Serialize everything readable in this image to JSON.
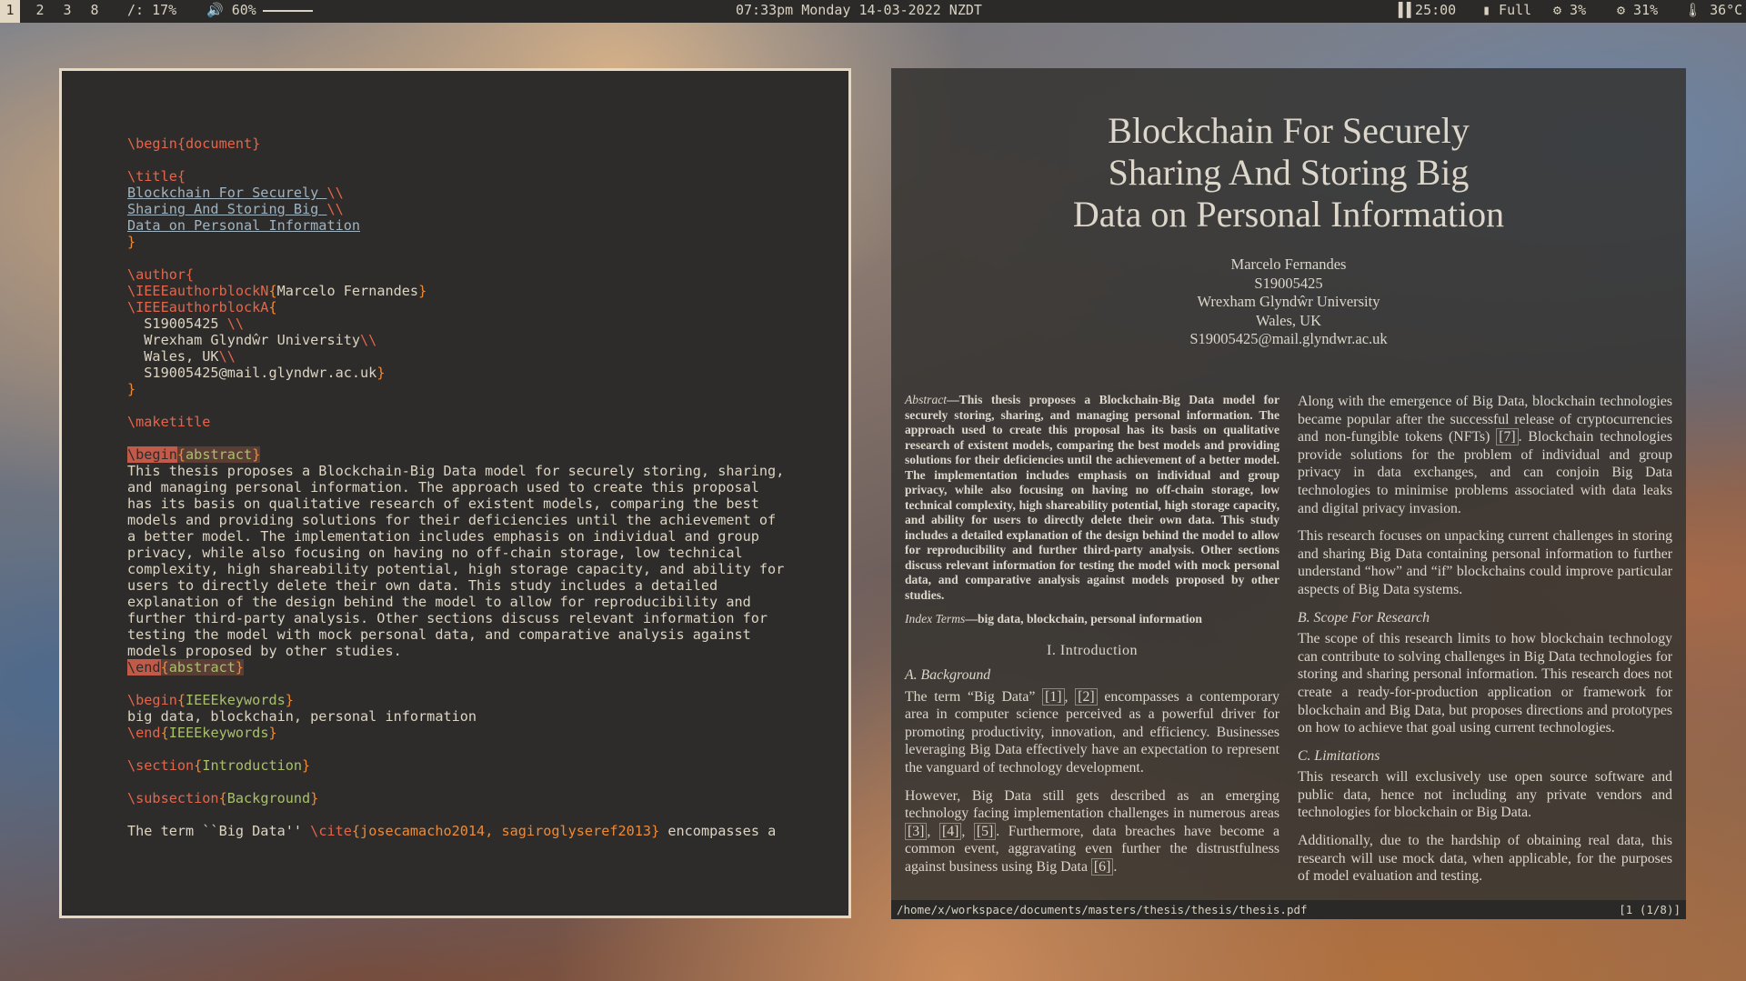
{
  "topbar": {
    "workspaces": [
      "1",
      "2",
      "3",
      "8"
    ],
    "disk": "/: 17%",
    "volume": "🔊 60%",
    "clock": "07:33pm Monday 14-03-2022 NZDT",
    "timer": "▌▌25:00",
    "battery": "▮ Full",
    "cpu": "⚙ 3%",
    "mem": "⚙ 31%",
    "temp": "🌡 36°C"
  },
  "editor": {
    "begin_document": "\\begin{document}",
    "title_cmd": "\\title{",
    "title_lines": [
      "Blockchain For Securely ",
      "Sharing And Storing Big ",
      "Data on Personal Information"
    ],
    "author_cmd": "\\author{",
    "author_name": "Marcelo Fernandes",
    "author_lines": [
      "  S19005425 ",
      "  Wrexham Glyndŵr University",
      "  Wales, UK",
      "  S19005425@mail.glyndwr.ac.uk"
    ],
    "maketitle": "\\maketitle",
    "abstract_lines": [
      "This thesis proposes a Blockchain-Big Data model for securely storing, sharing,",
      "and managing personal information. The approach used to create this proposal",
      "has its basis on qualitative research of existent models, comparing the best",
      "models and providing solutions for their deficiencies until the achievement of",
      "a better model. The implementation includes emphasis on individual and group",
      "privacy, while also focusing on having no off-chain storage, low technical",
      "complexity, high shareability potential, high storage capacity, and ability for",
      "users to directly delete their own data. This study includes a detailed",
      "explanation of the design behind the model to allow for reproducibility and",
      "further third-party analysis. Other sections discuss relevant information for",
      "testing the model with mock personal data, and comparative analysis against",
      "models proposed by other studies."
    ],
    "keywords": "big data, blockchain, personal information",
    "section": "Introduction",
    "subsection": "Background",
    "last_line_pre": "The term ``Big Data'' ",
    "cite_keys": "josecamacho2014, sagiroglyseref2013",
    "last_line_post": " encompasses a"
  },
  "pdf": {
    "title_lines": [
      "Blockchain For Securely",
      "Sharing And Storing Big",
      "Data on Personal Information"
    ],
    "author_lines": [
      "Marcelo Fernandes",
      "S19005425",
      "Wrexham Glyndŵr University",
      "Wales, UK",
      "S19005425@mail.glyndwr.ac.uk"
    ],
    "abstract_label": "Abstract",
    "abstract_text": "—This thesis proposes a Blockchain-Big Data model for securely storing, sharing, and managing personal information. The approach used to create this proposal has its basis on qualitative research of existent models, comparing the best models and providing solutions for their deficiencies until the achievement of a better model. The implementation includes emphasis on individual and group privacy, while also focusing on having no off-chain storage, low technical complexity, high shareability potential, high storage capacity, and ability for users to directly delete their own data. This study includes a detailed explanation of the design behind the model to allow for reproducibility and further third-party analysis. Other sections discuss relevant information for testing the model with mock personal data, and comparative analysis against models proposed by other studies.",
    "index_label": "Index Terms",
    "index_text": "—big data, blockchain, personal information",
    "section_head": "I. Introduction",
    "sub_a": "A. Background",
    "para1_a": "The term “Big Data” ",
    "para1_b": " encompasses a contemporary area in computer science perceived as a powerful driver for promoting productivity, innovation, and efficiency. Businesses leveraging Big Data effectively have an expectation to represent the vanguard of technology development.",
    "para2_a": "However, Big Data still gets described as an emerging technology facing implementation challenges in numerous areas ",
    "para2_b": ". Furthermore, data breaches have become a common event, aggravating even further the distrustfulness against business using Big Data ",
    "para3_a": "Along with the emergence of Big Data, blockchain technologies became popular after the successful release of cryptocurrencies and non-fungible tokens (NFTs) ",
    "para3_b": ". Blockchain technologies provide solutions for the problem of individual and group privacy in data exchanges, and can conjoin Big Data technologies to minimise problems associated with data leaks and digital privacy invasion.",
    "para4": "This research focuses on unpacking current challenges in storing and sharing Big Data containing personal information to further understand “how” and “if” blockchains could improve particular aspects of Big Data systems.",
    "sub_b": "B. Scope For Research",
    "para5": "The scope of this research limits to how blockchain technology can contribute to solving challenges in Big Data technologies for storing and sharing personal information. This research does not create a ready-for-production application or framework for blockchain and Big Data, but proposes directions and prototypes on how to achieve that goal using current technologies.",
    "sub_c": "C. Limitations",
    "para6": "This research will exclusively use open source software and public data, hence not including any private vendors and technologies for blockchain or Big Data.",
    "para7": "Additionally, due to the hardship of obtaining real data, this research will use mock data, when applicable, for the purposes of model evaluation and testing.",
    "refs": {
      "r1": "[1]",
      "r2": "[2]",
      "r3": "[3]",
      "r4": "[4]",
      "r5": "[5]",
      "r6": "[6]",
      "r7": "[7]"
    },
    "path": "/home/x/workspace/documents/masters/thesis/thesis/thesis.pdf",
    "page_info": "[1 (1/8)]"
  }
}
